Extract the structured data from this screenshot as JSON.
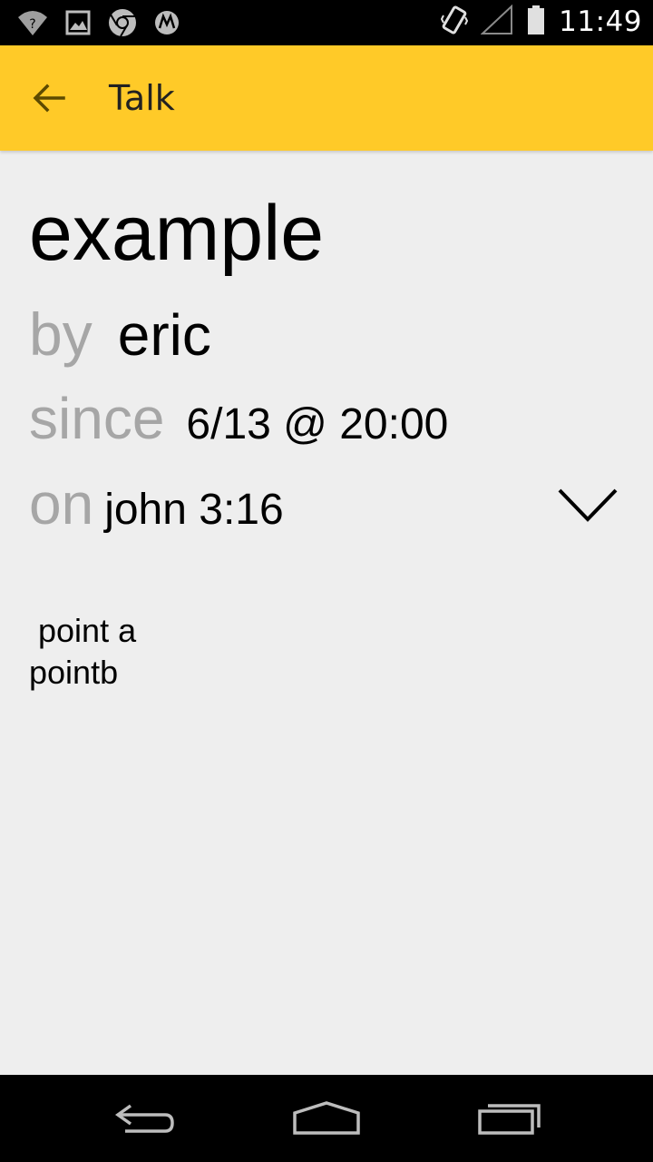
{
  "status_bar": {
    "time": "11:49",
    "icons": [
      "wifi-question-icon",
      "image-icon",
      "chrome-icon",
      "motorola-icon",
      "vibrate-icon",
      "signal-icon",
      "battery-icon"
    ]
  },
  "app_bar": {
    "title": "Talk",
    "accent": "#ffca28"
  },
  "talk": {
    "title": "example",
    "by_label": "by",
    "author": "eric",
    "since_label": "since",
    "date": "6/13 @ 20:00",
    "on_label": "on",
    "reference": "john 3:16",
    "notes": " point a\npointb"
  },
  "nav_bar": {
    "icons": [
      "back-nav-icon",
      "home-nav-icon",
      "recents-nav-icon"
    ]
  }
}
